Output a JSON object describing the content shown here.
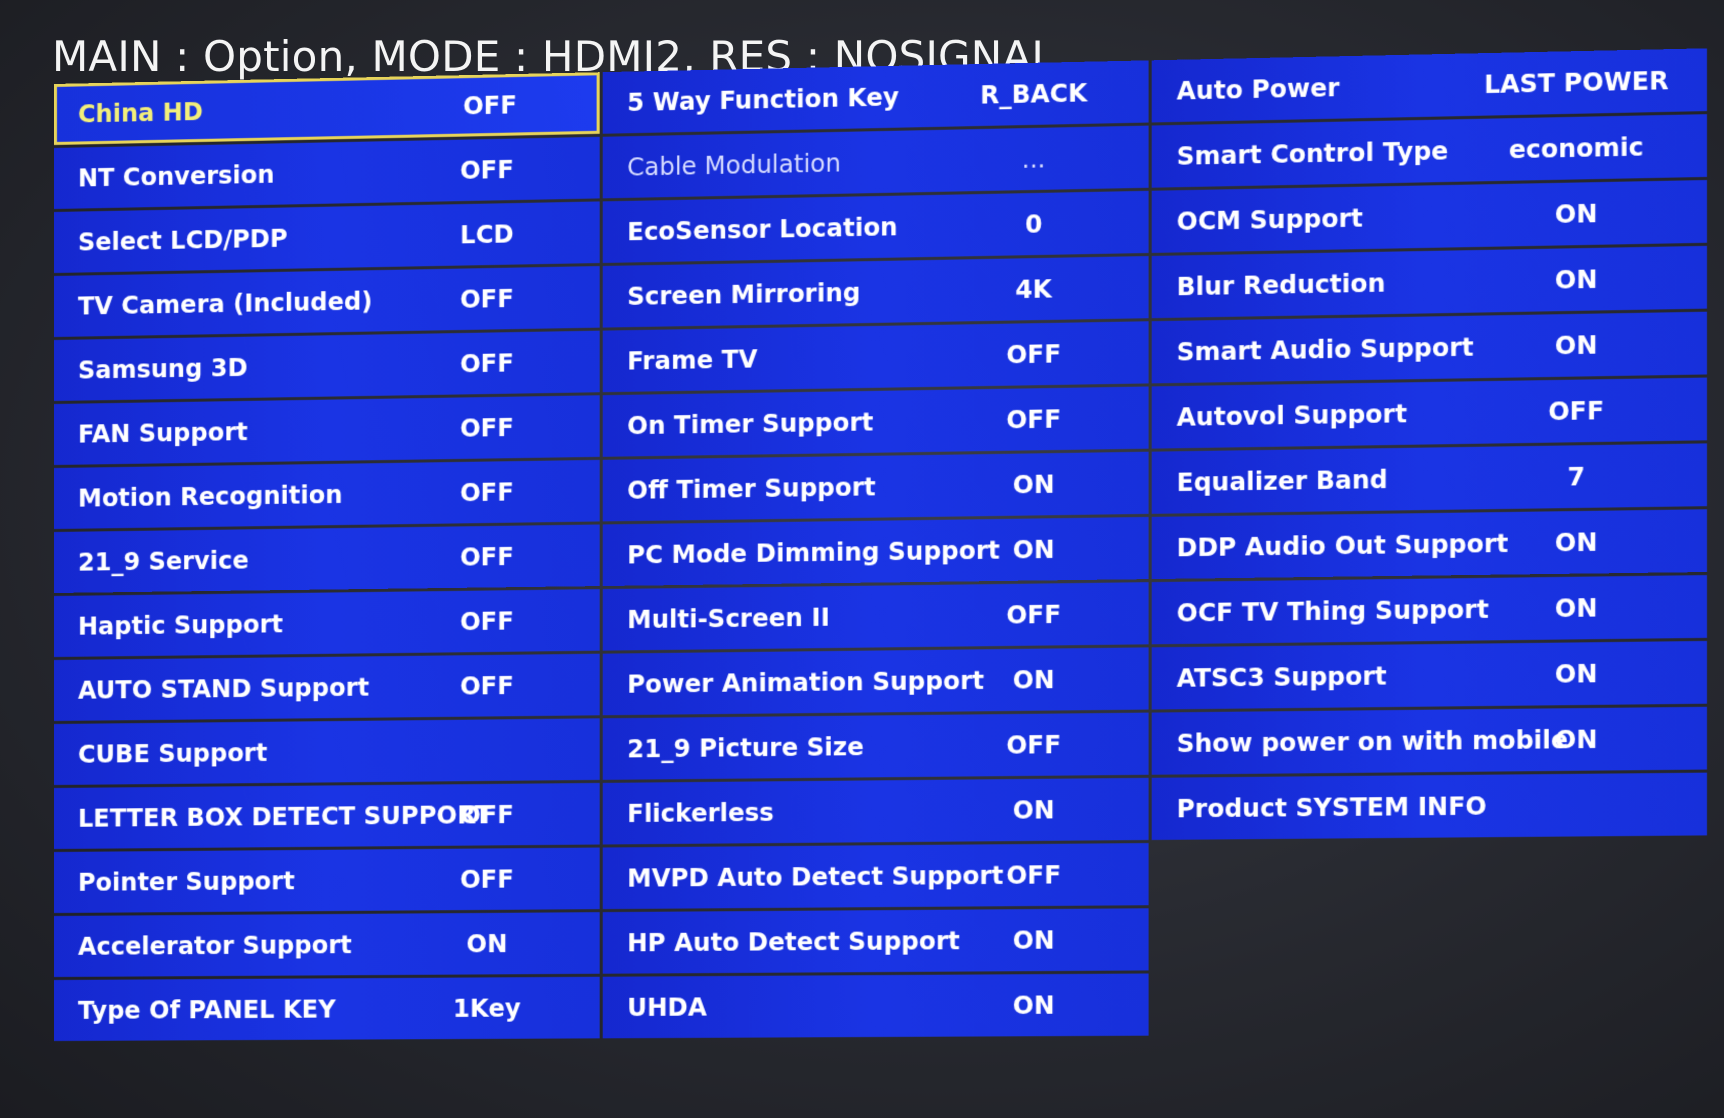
{
  "header": {
    "title": "MAIN : Option, MODE : HDMI2, RES : NOSIGNAL"
  },
  "colors": {
    "row_background": "#1a34e4",
    "focus_border": "#e7d45a",
    "focus_label": "#f3ef7a",
    "text": "#ffffff",
    "screen_background": "#2a2c33"
  },
  "columns": [
    {
      "rows": [
        {
          "label": "China HD",
          "value": "OFF",
          "focused": true
        },
        {
          "label": "NT Conversion",
          "value": "OFF"
        },
        {
          "label": "Select LCD/PDP",
          "value": "LCD"
        },
        {
          "label": "TV Camera (Included)",
          "value": "OFF"
        },
        {
          "label": "Samsung 3D",
          "value": "OFF"
        },
        {
          "label": "FAN Support",
          "value": "OFF"
        },
        {
          "label": "Motion Recognition",
          "value": "OFF"
        },
        {
          "label": "21_9 Service",
          "value": "OFF"
        },
        {
          "label": "Haptic Support",
          "value": "OFF"
        },
        {
          "label": "AUTO STAND Support",
          "value": "OFF"
        },
        {
          "label": "CUBE Support",
          "value": ""
        },
        {
          "label": "LETTER BOX DETECT SUPPORT",
          "value": "OFF"
        },
        {
          "label": "Pointer Support",
          "value": "OFF"
        },
        {
          "label": "Accelerator Support",
          "value": "ON"
        },
        {
          "label": "Type Of PANEL KEY",
          "value": "1Key"
        }
      ]
    },
    {
      "rows": [
        {
          "label": "5 Way Function Key",
          "value": "R_BACK"
        },
        {
          "label": "Cable Modulation",
          "value": "...",
          "dimmed": true
        },
        {
          "label": "EcoSensor Location",
          "value": "0"
        },
        {
          "label": "Screen Mirroring",
          "value": "4K"
        },
        {
          "label": "Frame TV",
          "value": "OFF"
        },
        {
          "label": "On Timer Support",
          "value": "OFF"
        },
        {
          "label": "Off Timer Support",
          "value": "ON"
        },
        {
          "label": "PC Mode Dimming Support",
          "value": "ON"
        },
        {
          "label": "Multi-Screen II",
          "value": "OFF"
        },
        {
          "label": "Power Animation Support",
          "value": "ON"
        },
        {
          "label": "21_9 Picture Size",
          "value": "OFF"
        },
        {
          "label": "Flickerless",
          "value": "ON"
        },
        {
          "label": "MVPD Auto Detect Support",
          "value": "OFF"
        },
        {
          "label": "HP Auto Detect Support",
          "value": "ON"
        },
        {
          "label": "UHDA",
          "value": "ON"
        }
      ]
    },
    {
      "rows": [
        {
          "label": "Auto Power",
          "value": "LAST POWER"
        },
        {
          "label": "Smart Control Type",
          "value": "economic"
        },
        {
          "label": "OCM Support",
          "value": "ON"
        },
        {
          "label": "Blur Reduction",
          "value": "ON"
        },
        {
          "label": "Smart Audio Support",
          "value": "ON"
        },
        {
          "label": "Autovol Support",
          "value": "OFF"
        },
        {
          "label": "Equalizer Band",
          "value": "7"
        },
        {
          "label": "DDP Audio Out Support",
          "value": "ON"
        },
        {
          "label": "OCF TV Thing Support",
          "value": "ON"
        },
        {
          "label": "ATSC3 Support",
          "value": "ON"
        },
        {
          "label": "Show power on with mobile",
          "value": "ON"
        },
        {
          "label": "Product SYSTEM INFO",
          "value": ""
        }
      ]
    }
  ]
}
